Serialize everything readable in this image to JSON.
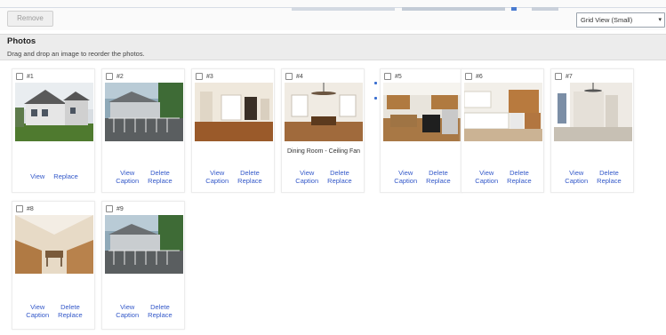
{
  "toolbar": {
    "remove_label": "Remove",
    "view_select": "Grid View (Small)"
  },
  "section": {
    "title": "Photos",
    "subtitle": "Drag and drop an image to reorder the photos."
  },
  "photos": [
    {
      "num": "#1",
      "caption": "",
      "links": [
        "View",
        "Replace"
      ]
    },
    {
      "num": "#2",
      "caption": "",
      "links": [
        "View",
        "Caption",
        "Delete",
        "Replace"
      ]
    },
    {
      "num": "#3",
      "caption": "",
      "links": [
        "View",
        "Caption",
        "Delete",
        "Replace"
      ]
    },
    {
      "num": "#4",
      "caption": "Dining Room - Ceiling Fan",
      "links": [
        "View",
        "Caption",
        "Delete",
        "Replace"
      ]
    },
    {
      "num": "#5",
      "caption": "",
      "links": [
        "View",
        "Caption",
        "Delete",
        "Replace"
      ]
    },
    {
      "num": "#6",
      "caption": "",
      "links": [
        "View",
        "Caption",
        "Delete",
        "Replace"
      ]
    },
    {
      "num": "#7",
      "caption": "",
      "links": [
        "View",
        "Caption",
        "Delete",
        "Replace"
      ]
    },
    {
      "num": "#8",
      "caption": "",
      "links": [
        "View",
        "Caption",
        "Delete",
        "Replace"
      ]
    },
    {
      "num": "#9",
      "caption": "",
      "links": [
        "View",
        "Caption",
        "Delete",
        "Replace"
      ]
    }
  ],
  "colors": {
    "link": "#3358c9",
    "header_bg": "#ececec",
    "select_border": "#9aa3ad"
  }
}
